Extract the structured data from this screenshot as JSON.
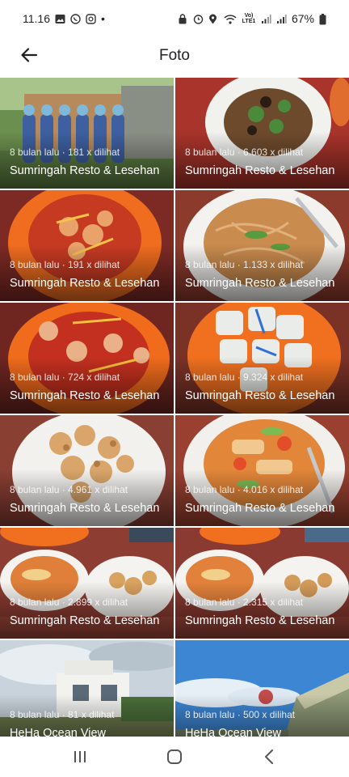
{
  "status_bar": {
    "time": "11.16",
    "left_icons": [
      "image-icon",
      "whatsapp-icon",
      "instagram-icon",
      "dot-icon"
    ],
    "right_icons": [
      "lock-icon",
      "alarm-icon",
      "location-icon",
      "wifi-icon",
      "volte-icon",
      "signal-icon",
      "signal-icon-2"
    ],
    "network_label": "Vo) LTE1",
    "battery_percent": "67%"
  },
  "app_bar": {
    "title": "Foto",
    "back_icon": "arrow-left-icon"
  },
  "photos": [
    {
      "meta": "8 bulan lalu · 181 x dilihat",
      "place": "Sumringah Resto & Lesehan",
      "scene": "group-outdoor"
    },
    {
      "meta": "8 bulan lalu · 6.603 x dilihat",
      "place": "Sumringah Resto & Lesehan",
      "scene": "soup-bowl"
    },
    {
      "meta": "8 bulan lalu · 191 x dilihat",
      "place": "Sumringah Resto & Lesehan",
      "scene": "sweet-sour-plate"
    },
    {
      "meta": "8 bulan lalu · 1.133 x dilihat",
      "place": "Sumringah Resto & Lesehan",
      "scene": "noodle-plate"
    },
    {
      "meta": "8 bulan lalu · 724 x dilihat",
      "place": "Sumringah Resto & Lesehan",
      "scene": "sweet-sour-plate-2"
    },
    {
      "meta": "8 bulan lalu · 9.324 x dilihat",
      "place": "Sumringah Resto & Lesehan",
      "scene": "dimsum-plate"
    },
    {
      "meta": "8 bulan lalu · 4.961 x dilihat",
      "place": "Sumringah Resto & Lesehan",
      "scene": "fried-plate"
    },
    {
      "meta": "8 bulan lalu · 4.016 x dilihat",
      "place": "Sumringah Resto & Lesehan",
      "scene": "capcay-bowl"
    },
    {
      "meta": "8 bulan lalu · 2.899 x dilihat",
      "place": "Sumringah Resto & Lesehan",
      "scene": "table-spread"
    },
    {
      "meta": "8 bulan lalu · 2.315 x dilihat",
      "place": "Sumringah Resto & Lesehan",
      "scene": "table-spread-2"
    },
    {
      "meta": "8 bulan lalu · 81 x dilihat",
      "place": "HeHa Ocean View",
      "scene": "building-sky"
    },
    {
      "meta": "8 bulan lalu · 500 x dilihat",
      "place": "HeHa Ocean View",
      "scene": "ocean-cliff"
    }
  ],
  "nav_bar": {
    "recents_icon": "recents-icon",
    "home_icon": "home-icon",
    "back_icon": "chevron-left-icon"
  },
  "colors": {
    "tile_text": "#ffffff",
    "meta_text": "#e6e6e6",
    "title_text": "#202124"
  }
}
